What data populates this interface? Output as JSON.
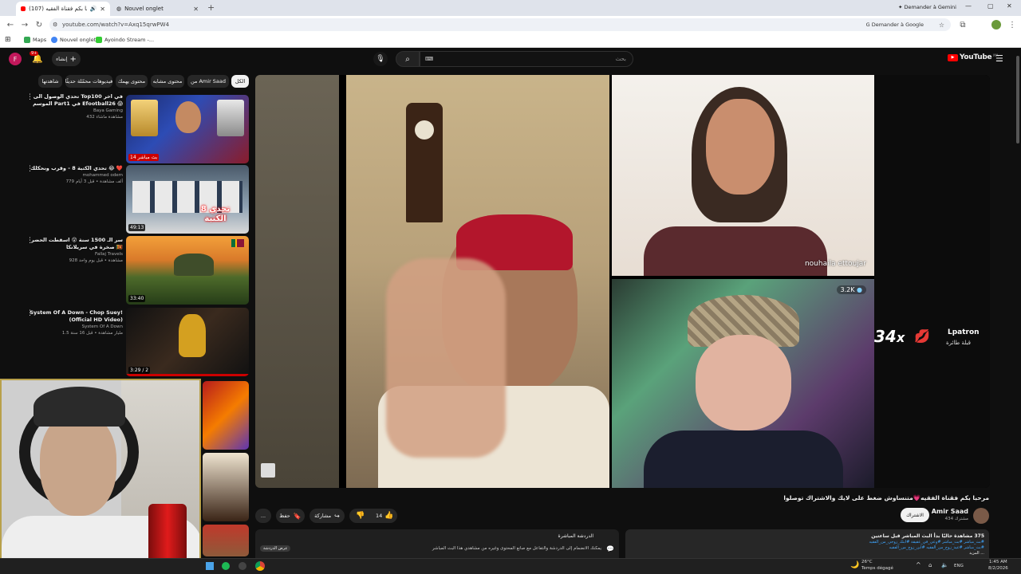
{
  "browser": {
    "tabs": [
      {
        "title": "(107) مرحبا بكم فقناة الفقيه #",
        "active": true
      },
      {
        "title": "Nouvel onglet",
        "active": false
      }
    ],
    "gemini_label": "Demander à Gemini",
    "url": "youtube.com/watch?v=Axq15qrwPW4",
    "ask_google": "Demander à Google",
    "bookmarks": [
      "Maps",
      "Nouvel onglet",
      "Ayoindo Stream -..."
    ]
  },
  "youtube": {
    "avatar_letter": "F",
    "notif_badge": "9+",
    "create_label": "إنشاء",
    "search_placeholder": "بحث",
    "logo_text": "YouTube",
    "logo_region": "MA",
    "chips": [
      "الكل",
      "من Amir Saad",
      "محتوى مشابه",
      "محتوى يهمك",
      "فيديوهات محمّلة حديثًا",
      "شاهدتها"
    ],
    "recommendations": [
      {
        "title": "تحدي الوصول الى Top100 في اخر الموسم Part1 في Efootball26 😱",
        "channel": "Baya Gaming",
        "meta": "432 مشاهدة ماشاء",
        "duration": "14 بث مباشر",
        "thumb_text": ""
      },
      {
        "title": "تحدي الكتبة 8 - وقرب ونحكلك 😂 ❤️",
        "channel": "mohammed odem",
        "meta": "779 ألف مشاهدة • قبل 3 أيام",
        "duration": "49:13",
        "thumb_text": "تحدي 8 الكتبة"
      },
      {
        "title": "سر الـ 1500 سنة 😲 اسقطت الحضر صخرة في سريلانكا 🇱🇰",
        "channel": "Fallaj Travels",
        "meta": "928 مشاهدة • قبل يوم واحد",
        "duration": "33:40",
        "thumb_text": ""
      },
      {
        "title": "System Of A Down - Chop Suey! (Official HD Video)",
        "channel": "System Of A Down",
        "meta": "1.5 مليار مشاهدة • قبل 16 سنة",
        "duration": "3:29 / 2",
        "thumb_text": ""
      }
    ],
    "video": {
      "title": "مرحبا بكم فقناة الفقيه💗متنساوش ضغط على لايك والاشتراك توصلوا",
      "participant_name": "nouhaila ettoujar",
      "viewer_count": "3.2K",
      "gift_count": "34",
      "gift_multiplier": "x",
      "gift_user": "Lpatron",
      "gift_sub": "قبلة طائرة"
    },
    "channel": {
      "name": "Amir Saad",
      "subs": "434 مشترك",
      "subscribe_label": "الاشتراك"
    },
    "actions": {
      "likes": "14",
      "share": "مشاركة",
      "save": "حفظ",
      "more": "..."
    },
    "live_chat": {
      "title": "الدردشة المباشرة",
      "text": "يمكنك الانضمام إلى الدردشة والتفاعل مع صانع المحتوى وغيره من مشاهدي هذا البث المباشر",
      "button": "عرض الدردشة"
    },
    "description": {
      "stats": "375 مشاهدة حاليًا  بدأ البث المباشر قبل ساعتين",
      "line2": "#بث_مباشر #بث_مباشر #وعي_في_عقيقة #ابنك_زوجي_من_الفقيه",
      "line3": "#بث_مباشر #عيد_زوج_من_الفقيه #ابن_زوج_من_الفقيه",
      "line4": "... المزيد"
    }
  },
  "taskbar": {
    "temperature": "26°C",
    "weather": "Temps dégagé",
    "lang": "ENG",
    "time": "1:45 AM",
    "date": "8/2/2026"
  },
  "colors": {
    "yt_red": "#ff0000",
    "bg": "#0f0f0f",
    "chip": "#272727"
  }
}
